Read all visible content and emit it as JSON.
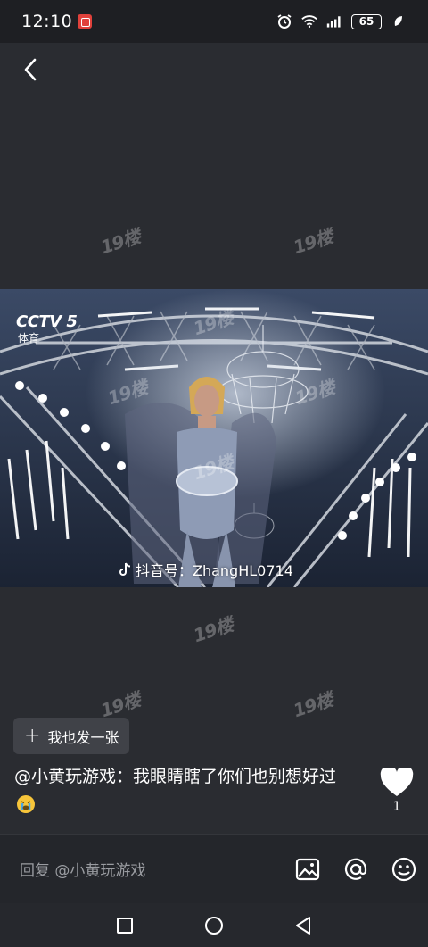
{
  "status_bar": {
    "time": "12:10",
    "battery": "65"
  },
  "watermark_text": "19楼",
  "media": {
    "channel_logo": "CCTV 5",
    "channel_sub": "体育",
    "tiktok_label": "抖音号：ZhangHL0714"
  },
  "post_one_button": {
    "label": "我也发一张"
  },
  "comment": {
    "text": "@小黄玩游戏：我眼睛瞎了你们也别想好过"
  },
  "like": {
    "count": "1"
  },
  "reply": {
    "placeholder": "回复 @小黄玩游戏"
  },
  "colors": {
    "background": "#2a2c31",
    "status_bar": "#1e1f23",
    "button_bg": "#404248",
    "placeholder": "#9a9ca1"
  },
  "icons": [
    "back-arrow-icon",
    "alarm-icon",
    "wifi-icon",
    "signal-icon",
    "battery-icon",
    "leaf-icon",
    "plus-icon",
    "heart-icon",
    "image-icon",
    "at-icon",
    "smiley-icon",
    "square-icon",
    "circle-icon",
    "triangle-back-icon"
  ]
}
